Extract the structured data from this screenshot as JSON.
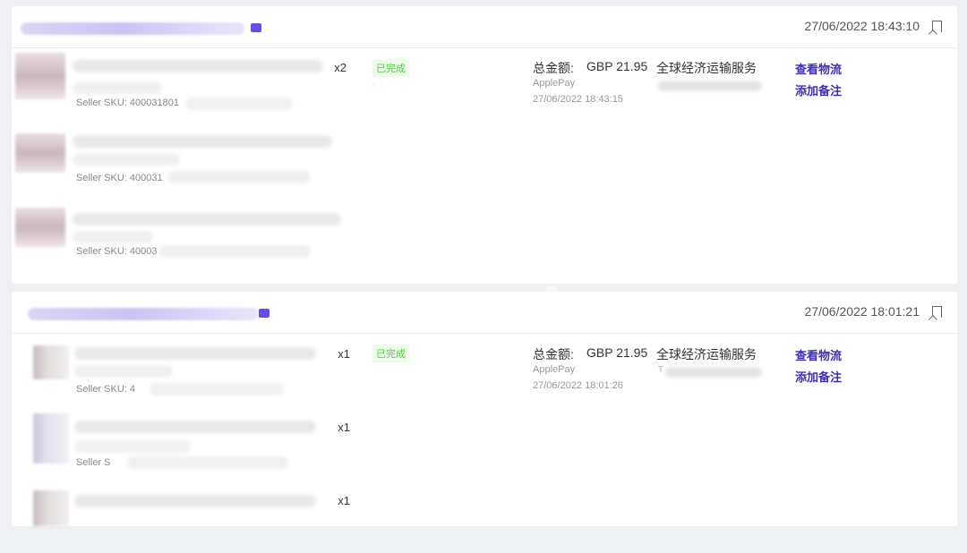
{
  "orders": [
    {
      "time": "27/06/2022 18:43:10",
      "items": [
        {
          "qty": "x2",
          "sku": "Seller SKU: 400031801"
        },
        {
          "qty": "",
          "sku": "Seller SKU: 400031"
        },
        {
          "qty": "",
          "sku": "Seller SKU: 40003"
        }
      ],
      "status": "已完成",
      "total_label": "总金额:",
      "total_value": "GBP 21.95",
      "pay_method": "ApplePay",
      "pay_time": "27/06/2022 18:43:15",
      "shipping": "全球经济运输服务",
      "tracking_prefix": "",
      "actions": {
        "logistics": "查看物流",
        "note": "添加备注"
      }
    },
    {
      "time": "27/06/2022 18:01:21",
      "items": [
        {
          "qty": "x1",
          "sku": "Seller SKU: 4"
        },
        {
          "qty": "x1",
          "sku": "Seller S"
        },
        {
          "qty": "x1",
          "sku": ""
        }
      ],
      "status": "已完成",
      "total_label": "总金额:",
      "total_value": "GBP 21.95",
      "pay_method": "ApplePay",
      "pay_time": "27/06/2022 18:01:26",
      "shipping": "全球经济运输服务",
      "tracking_prefix": "T",
      "actions": {
        "logistics": "查看物流",
        "note": "添加备注"
      }
    }
  ]
}
